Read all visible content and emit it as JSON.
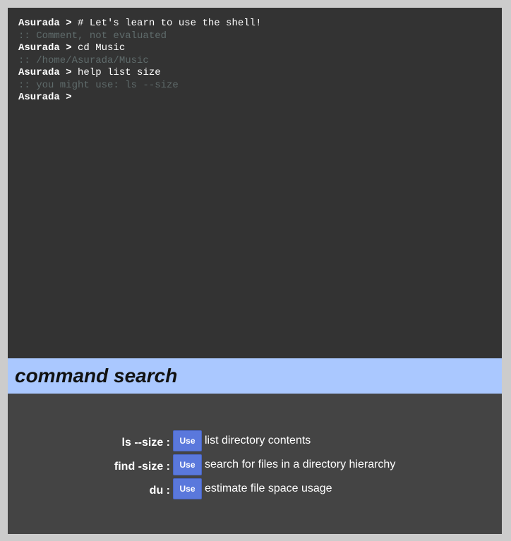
{
  "terminal": {
    "lines": [
      {
        "type": "input",
        "prompt": "Asurada >",
        "text": " # Let's learn to use the shell!"
      },
      {
        "type": "output",
        "text": ":: Comment, not evaluated"
      },
      {
        "type": "input",
        "prompt": "Asurada >",
        "text": " cd Music"
      },
      {
        "type": "output",
        "text": ":: /home/Asurada/Music"
      },
      {
        "type": "input",
        "prompt": "Asurada >",
        "text": " help list size"
      },
      {
        "type": "output",
        "text": ":: you might use: ls --size"
      },
      {
        "type": "input",
        "prompt": "Asurada >",
        "text": ""
      }
    ]
  },
  "search": {
    "title": "command search",
    "results": [
      {
        "name": "ls --size :",
        "button_label": "Use",
        "description": "list directory contents"
      },
      {
        "name": "find -size :",
        "button_label": "Use",
        "description": "search for files in a directory hierarchy"
      },
      {
        "name": "du :",
        "button_label": "Use",
        "description": "estimate file space usage"
      }
    ]
  },
  "colors": {
    "background": "#cccccc",
    "terminal_bg": "#333333",
    "header_bg": "#aac8ff",
    "results_bg": "#444444",
    "output_text": "#5f6b6b",
    "button": "#5a78dc"
  }
}
